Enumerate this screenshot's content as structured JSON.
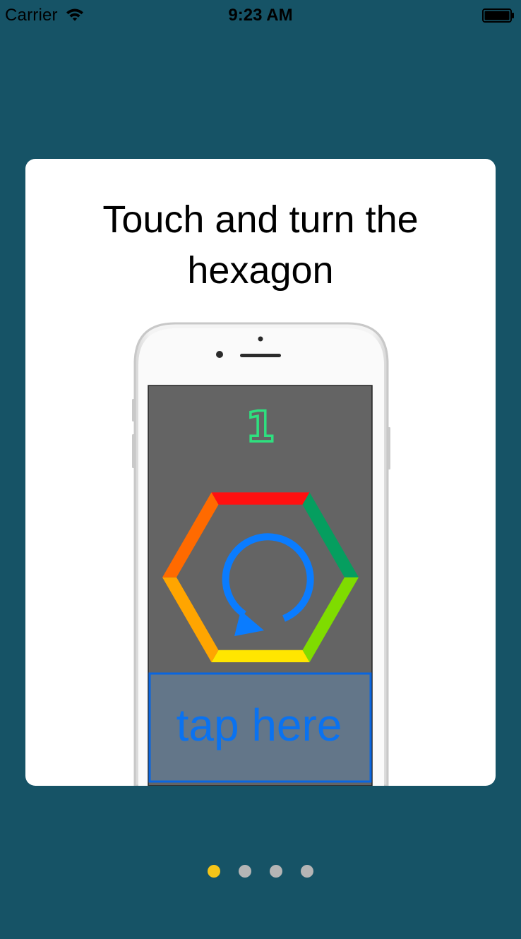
{
  "status_bar": {
    "carrier": "Carrier",
    "time": "9:23 AM",
    "wifi_icon": "wifi-icon",
    "battery_icon": "battery-icon"
  },
  "card": {
    "title": "Touch and turn the hexagon",
    "illustration": {
      "score": "1",
      "tap_label": "tap here",
      "rotate_icon": "rotate-arrow-icon",
      "hexagon_colors": [
        "#ff1010",
        "#059e5f",
        "#7fdc00",
        "#ffe600",
        "#ffa500",
        "#ff6a00"
      ]
    }
  },
  "pager": {
    "count": 4,
    "active_index": 0,
    "active_color": "#f5c518",
    "inactive_color": "#b5b5b5"
  },
  "colors": {
    "background": "#165366",
    "card": "#ffffff",
    "score": "#2ee07f",
    "tap_text": "#0a72f0"
  }
}
